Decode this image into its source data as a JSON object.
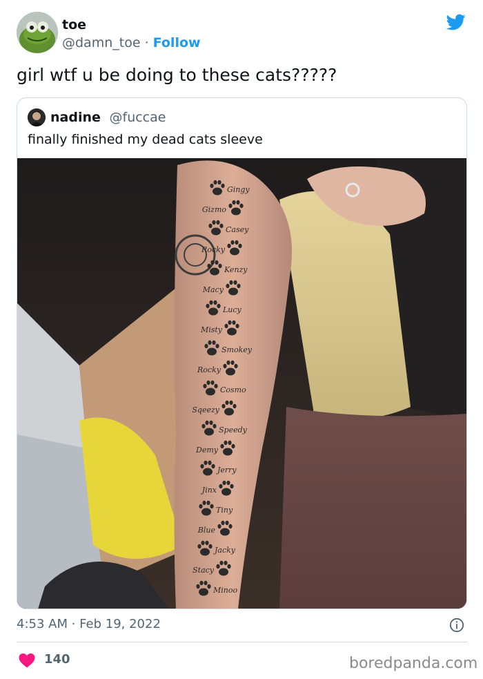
{
  "author": {
    "name": "toe",
    "handle": "@damn_toe",
    "separator": "·",
    "follow_label": "Follow"
  },
  "tweet": {
    "text": "girl wtf u be doing to these cats?????",
    "timestamp": "4:53 AM · Feb 19, 2022",
    "likes": "140"
  },
  "quoted": {
    "name": "nadine",
    "handle": "@fuccae",
    "text": "finally finished my dead cats sleeve",
    "tattoo_names": [
      "Gingy",
      "Gizmo",
      "Casey",
      "Rocky",
      "Kenzy",
      "Macy",
      "Lucy",
      "Misty",
      "Smokey",
      "Rocky",
      "Cosmo",
      "Sqeezy",
      "Speedy",
      "Demy",
      "Jerry",
      "Jinx",
      "Tiny",
      "Blue",
      "Jacky",
      "Stacy",
      "Minoo"
    ]
  },
  "watermark": "boredpanda.com",
  "icons": {
    "brand": "twitter-bird-icon",
    "info": "info-icon",
    "like": "heart-icon"
  },
  "colors": {
    "accent": "#1d9bf0",
    "heart": "#f91880",
    "muted": "#536471",
    "border": "#cfd9de"
  }
}
